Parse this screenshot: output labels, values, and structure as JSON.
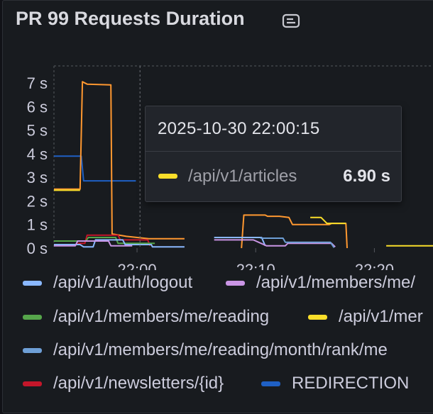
{
  "panel": {
    "title": "PR 99 Requests Duration",
    "title_icon": "description-note-icon"
  },
  "tooltip": {
    "time": "2025-10-30 22:00:15",
    "series": "/api/v1/articles",
    "value": "6.90 s",
    "color": "#fade2a"
  },
  "legend": [
    {
      "label": "/api/v1/auth/logout",
      "color": "#8ab8ff"
    },
    {
      "label": "/api/v1/members/me/",
      "color": "#ca95e5"
    },
    {
      "label": "/api/v1/members/me/reading",
      "color": "#56a64b"
    },
    {
      "label": "/api/v1/mer",
      "color": "#fade2a"
    },
    {
      "label": "/api/v1/members/me/reading/month/rank/me",
      "color": "#6e9fd6"
    },
    {
      "label": "/api/v1/newsletters/{id}",
      "color": "#c4162a"
    },
    {
      "label": "REDIRECTION",
      "color": "#1f60c4"
    }
  ],
  "chart_data": {
    "type": "line",
    "ylim": [
      0,
      7
    ],
    "y_unit": "s",
    "y_ticks": [
      "0 s",
      "1 s",
      "2 s",
      "3 s",
      "4 s",
      "5 s",
      "6 s",
      "7 s"
    ],
    "x_ticks": [
      {
        "label": "22:00",
        "t": 1320
      },
      {
        "label": "22:10",
        "t": 1330
      },
      {
        "label": "22:20",
        "t": 1340
      }
    ],
    "xlim": [
      1313,
      1345
    ],
    "series": [
      {
        "color": "#1f60c4",
        "points": [
          [
            1313,
            3.9
          ],
          [
            1315,
            3.9
          ],
          [
            1315.3,
            3.9
          ],
          [
            1315.5,
            2.85
          ],
          [
            1319,
            2.85
          ],
          [
            1319.9,
            2.85
          ]
        ]
      },
      {
        "color": "#ff9830",
        "points": [
          [
            1313,
            2.5
          ],
          [
            1315.2,
            2.5
          ],
          [
            1315.4,
            7.05
          ],
          [
            1315.8,
            6.95
          ],
          [
            1317.8,
            6.92
          ],
          [
            1317.8,
            6.92
          ],
          [
            1317.9,
            0.6
          ],
          [
            1319.1,
            0.5
          ],
          [
            1321,
            0.4
          ],
          [
            1324,
            0.4
          ],
          [
            null,
            null
          ],
          [
            1328.8,
            0
          ],
          [
            1329.0,
            1.4
          ],
          [
            1330.8,
            1.4
          ],
          [
            1331,
            1.35
          ],
          [
            1332,
            1.35
          ],
          [
            1332.8,
            1.3
          ],
          [
            1333.1,
            1.0
          ],
          [
            1336.2,
            1.0
          ],
          [
            1336.4,
            1.05
          ],
          [
            1337.6,
            1.05
          ],
          [
            1337.7,
            0
          ]
        ]
      },
      {
        "color": "#fade2a",
        "points": [
          [
            1313,
            2.45
          ],
          [
            1315.2,
            2.45
          ],
          [
            null,
            null
          ],
          [
            1334.6,
            1.3
          ],
          [
            1335.5,
            1.3
          ],
          [
            1336,
            1.05
          ],
          [
            1337.6,
            1.05
          ],
          [
            null,
            null
          ],
          [
            1341,
            0.1
          ],
          [
            1345,
            0.1
          ]
        ]
      },
      {
        "color": "#c4162a",
        "points": [
          [
            1315,
            0.2
          ],
          [
            1315.6,
            0.2
          ],
          [
            1315.8,
            0.55
          ],
          [
            1318.4,
            0.55
          ],
          [
            1318.6,
            0.35
          ],
          [
            1320.9,
            0.35
          ],
          [
            1321.1,
            0.1
          ]
        ]
      },
      {
        "color": "#56a64b",
        "points": [
          [
            1313,
            0.3
          ],
          [
            1315.7,
            0.3
          ],
          [
            1315.9,
            0.45
          ],
          [
            1318.2,
            0.45
          ],
          [
            1318.4,
            0.2
          ],
          [
            1321.5,
            0.2
          ]
        ]
      },
      {
        "color": "#8ab8ff",
        "points": [
          [
            1313,
            0.15
          ],
          [
            1315.2,
            0.15
          ],
          [
            1315.5,
            0.05
          ],
          [
            1316.3,
            0.05
          ],
          [
            1316.5,
            0.35
          ],
          [
            1318.8,
            0.35
          ],
          [
            1319,
            0.15
          ],
          [
            1321.2,
            0.15
          ],
          [
            1321.3,
            0.05
          ],
          [
            1324,
            0.05
          ],
          [
            null,
            null
          ],
          [
            1326.5,
            0.45
          ],
          [
            1330.5,
            0.45
          ],
          [
            1330.8,
            0.1
          ]
        ]
      },
      {
        "color": "#ca95e5",
        "points": [
          [
            1313,
            0.1
          ],
          [
            1314.8,
            0.1
          ],
          [
            1315,
            0.3
          ],
          [
            1317.6,
            0.3
          ],
          [
            1317.8,
            0.1
          ],
          [
            1319.6,
            0.1
          ],
          [
            null,
            null
          ],
          [
            1326.5,
            0.35
          ],
          [
            1329.8,
            0.35
          ],
          [
            1330.9,
            0.1
          ],
          [
            1332.5,
            0.1
          ],
          [
            1332.7,
            0.2
          ],
          [
            1336.4,
            0.2
          ],
          [
            1336.7,
            0.05
          ]
        ]
      },
      {
        "color": "#6e9fd6",
        "points": [
          [
            1330.4,
            0.42
          ],
          [
            1332.3,
            0.42
          ],
          [
            1332.5,
            0.25
          ],
          [
            1336.3,
            0.25
          ],
          [
            1336.6,
            0.02
          ]
        ]
      }
    ],
    "hover_t": 1320.25
  }
}
